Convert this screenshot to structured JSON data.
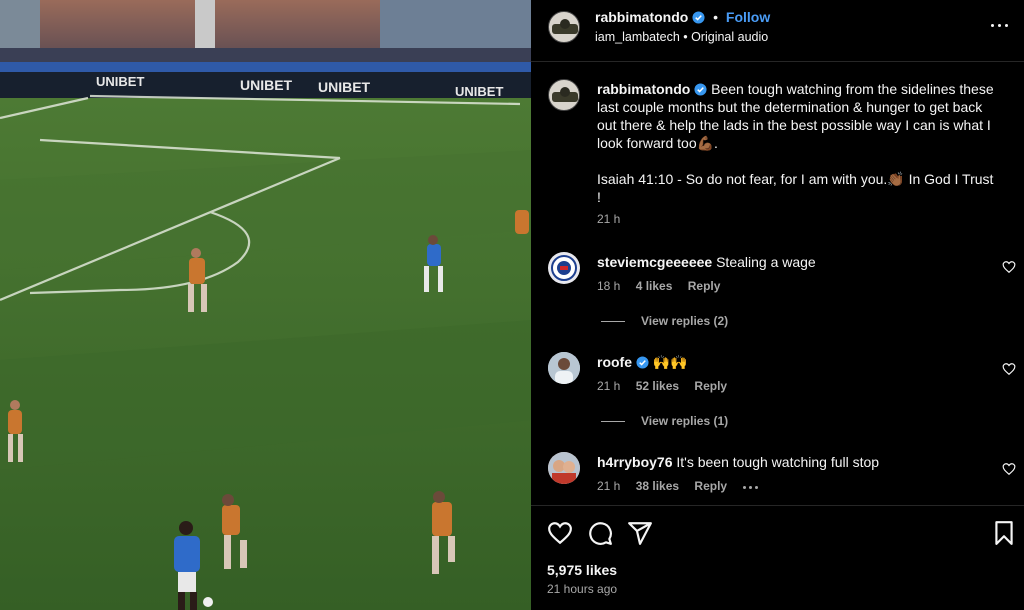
{
  "post": {
    "username": "rabbimatondo",
    "follow_label": "Follow",
    "separator": "•",
    "audio_credit": "iam_lambatech • Original audio",
    "more_icon": "more-horizontal-icon",
    "caption_line1": "Been tough watching from the sidelines these last couple months but the determination & hunger to get back out there & help the lads in the best possible way I can is what I look forward too💪🏾.",
    "caption_line2": "Isaiah 41:10 - So do not fear, for I am with you.👏🏾 In God I Trust !",
    "caption_time": "21 h"
  },
  "comments": [
    {
      "username": "steviemcgeeeeee",
      "text": "Stealing a wage",
      "time": "18 h",
      "likes": "4 likes",
      "reply": "Reply",
      "view_replies": "View replies (2)"
    },
    {
      "username": "roofe",
      "text": "🙌🙌",
      "time": "21 h",
      "likes": "52 likes",
      "reply": "Reply",
      "view_replies": "View replies (1)",
      "verified": true
    },
    {
      "username": "h4rryboy76",
      "text": "It's been tough watching full stop",
      "time": "21 h",
      "likes": "38 likes",
      "reply": "Reply"
    }
  ],
  "footer": {
    "likes": "5,975 likes",
    "time_ago": "21 hours ago"
  },
  "media": {
    "ad_boards": [
      "UNIBET",
      "UNIBET",
      "UNIBET",
      "UNIBET"
    ]
  },
  "colors": {
    "background": "#000000",
    "link": "#4a9cf6",
    "muted": "#a8a8a8",
    "verified": "#3797f0",
    "pitch": "#3f6a2c"
  }
}
